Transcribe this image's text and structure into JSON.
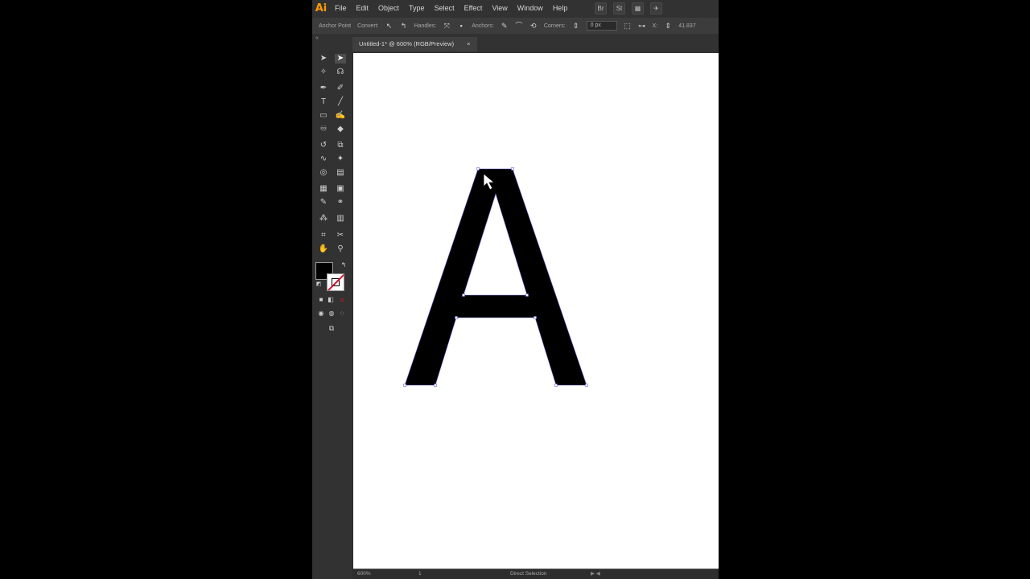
{
  "app": {
    "logo": "Ai",
    "menus": [
      "File",
      "Edit",
      "Object",
      "Type",
      "Select",
      "Effect",
      "View",
      "Window",
      "Help"
    ],
    "right_icons": [
      "br-icon",
      "St",
      "workspace-icon",
      "search-icon"
    ]
  },
  "controlbar": {
    "anchor_point": "Anchor Point",
    "convert": "Convert:",
    "handles": "Handles:",
    "anchors": "Anchors:",
    "corners": "Corners:",
    "corner_value": "0 px",
    "x_label": "X:",
    "x_value": "41.837"
  },
  "document": {
    "tab_title": "Untitled-1* @ 600% (RGB/Preview)",
    "close": "×"
  },
  "statusbar": {
    "zoom": "600%",
    "artboard": "1",
    "tool": "Direct Selection"
  },
  "artwork": {
    "glyph": "A",
    "fill": "#000000",
    "selection_color": "#6b6bd6"
  },
  "colors": {
    "accent": "#ff9a00",
    "ui_bg": "#323232",
    "canvas": "#ffffff",
    "none_slash": "#d0102b"
  }
}
